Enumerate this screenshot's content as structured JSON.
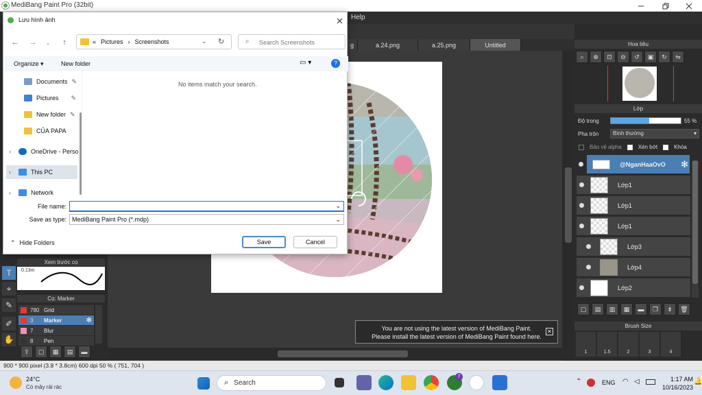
{
  "app": {
    "title": "MediBang Paint Pro (32bit)"
  },
  "menu": {
    "help": "Help"
  },
  "tabs": [
    {
      "label": "g"
    },
    {
      "label": "a.24.png"
    },
    {
      "label": "a.25.png"
    },
    {
      "label": "Untitled"
    }
  ],
  "navigator": {
    "title": "Hoa tiêu"
  },
  "layers": {
    "title": "Lớp",
    "opacity_label": "Độ trong",
    "opacity_value": "55 %",
    "opacity_fraction": 0.55,
    "blend_label": "Pha trộn",
    "blend_value": "Bình thường",
    "protect_alpha": "Bảo vệ alpha",
    "clip": "Xén bớt",
    "lock": "Khóa",
    "items": [
      {
        "name": "@NganHaaOvO"
      },
      {
        "name": "Lớp1"
      },
      {
        "name": "Lớp1"
      },
      {
        "name": "Lớp1"
      },
      {
        "name": "Lớp3"
      },
      {
        "name": "Lớp4"
      },
      {
        "name": "Lớp2"
      }
    ]
  },
  "brush_size": {
    "title": "Brush Size",
    "values": [
      "1",
      "1.5",
      "2",
      "3",
      "4"
    ]
  },
  "brush_preview": {
    "title": "Xem trước cọ",
    "size": "0.13m"
  },
  "brush_list": {
    "title": "Cọ: Marker",
    "items": [
      {
        "num": "780",
        "name": "Grid",
        "color": "#e53935"
      },
      {
        "num": "3",
        "name": "Marker",
        "color": "#e53935"
      },
      {
        "num": "7",
        "name": "Blur",
        "color": "#f48fb1"
      },
      {
        "num": "8",
        "name": "Pen",
        "color": "#333333"
      }
    ]
  },
  "status": {
    "text": "900 * 900 pixel  (3.8 * 3.8cm)  600 dpi  50 %  ( 751, 704 )"
  },
  "notice": {
    "line1": "You are not using the latest version of MediBang Paint.",
    "line2": "Please install the latest version of MediBang Paint found here."
  },
  "dialog": {
    "title": "Lưu hình ảnh",
    "breadcrumb": [
      "«",
      "Pictures",
      "Screenshots"
    ],
    "search_placeholder": "Search Screenshots",
    "organize": "Organize",
    "new_folder": "New folder",
    "empty_message": "No items match your search.",
    "nav_items": [
      {
        "label": "Documents"
      },
      {
        "label": "Pictures"
      },
      {
        "label": "New folder"
      },
      {
        "label": "CỦA PAPA"
      },
      {
        "label": "OneDrive - Perso"
      },
      {
        "label": "This PC"
      },
      {
        "label": "Network"
      }
    ],
    "file_name_label": "File name:",
    "file_name_value": "",
    "save_type_label": "Save as type:",
    "save_type_value": "MediBang Paint Pro (*.mdp)",
    "hide_folders": "Hide Folders",
    "save": "Save",
    "cancel": "Cancel"
  },
  "taskbar": {
    "weather_temp": "24°C",
    "weather_desc": "Có mây rải rác",
    "search": "Search",
    "lang": "ENG",
    "time": "1:17 AM",
    "date": "10/16/2023",
    "badge": "7"
  }
}
